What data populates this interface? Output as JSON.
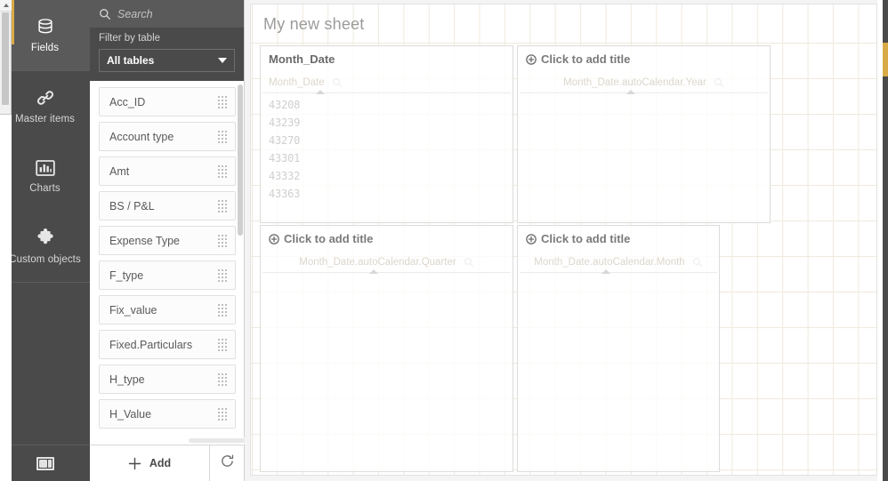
{
  "rail": {
    "items": [
      {
        "label": "Fields",
        "icon": "database-icon",
        "active": true
      },
      {
        "label": "Master items",
        "icon": "link-icon",
        "active": false
      },
      {
        "label": "Charts",
        "icon": "bar-chart-icon",
        "active": false
      },
      {
        "label": "Custom objects",
        "icon": "puzzle-piece-icon",
        "active": false
      }
    ],
    "collapse_icon": "collapse-panel-icon"
  },
  "search": {
    "placeholder": "Search",
    "value": "",
    "icon": "search-icon"
  },
  "filter": {
    "label": "Filter by table",
    "selected": "All tables",
    "caret_icon": "chevron-down-icon",
    "options": [
      "All tables"
    ]
  },
  "fields": {
    "items": [
      {
        "name": "Acc_ID"
      },
      {
        "name": "Account type"
      },
      {
        "name": "Amt"
      },
      {
        "name": "BS / P&L"
      },
      {
        "name": "Expense Type"
      },
      {
        "name": "F_type"
      },
      {
        "name": "Fix_value"
      },
      {
        "name": "Fixed.Particulars"
      },
      {
        "name": "H_type"
      },
      {
        "name": "H_Value"
      }
    ],
    "grip_icon": "drag-grip-icon"
  },
  "footer": {
    "add_label": "Add",
    "add_icon": "plus-icon",
    "reload_icon": "reload-icon"
  },
  "sheet": {
    "title": "My new sheet",
    "objects": [
      {
        "title": "Month_Date",
        "is_placeholder": false,
        "field_label": "Month_Date",
        "search_icon": "magnifier-icon",
        "values": [
          "43208",
          "43239",
          "43270",
          "43301",
          "43332",
          "43363"
        ]
      },
      {
        "title": "Click to add title",
        "is_placeholder": true,
        "add_icon": "plus-circle-icon",
        "field_label": "Month_Date.autoCalendar.Year",
        "search_icon": "magnifier-icon",
        "values": []
      },
      {
        "title": "Click to add title",
        "is_placeholder": true,
        "add_icon": "plus-circle-icon",
        "field_label": "Month_Date.autoCalendar.Quarter",
        "search_icon": "magnifier-icon",
        "values": []
      },
      {
        "title": "Click to add title",
        "is_placeholder": true,
        "add_icon": "plus-circle-icon",
        "field_label": "Month_Date.autoCalendar.Month",
        "search_icon": "magnifier-icon",
        "values": []
      }
    ]
  },
  "colors": {
    "rail_bg": "#4a4a4a",
    "rail_active": "#5a5a5a",
    "accent": "#d9ab46",
    "grid_line": "#f0e9dd",
    "text_muted": "#9b9b9b"
  }
}
